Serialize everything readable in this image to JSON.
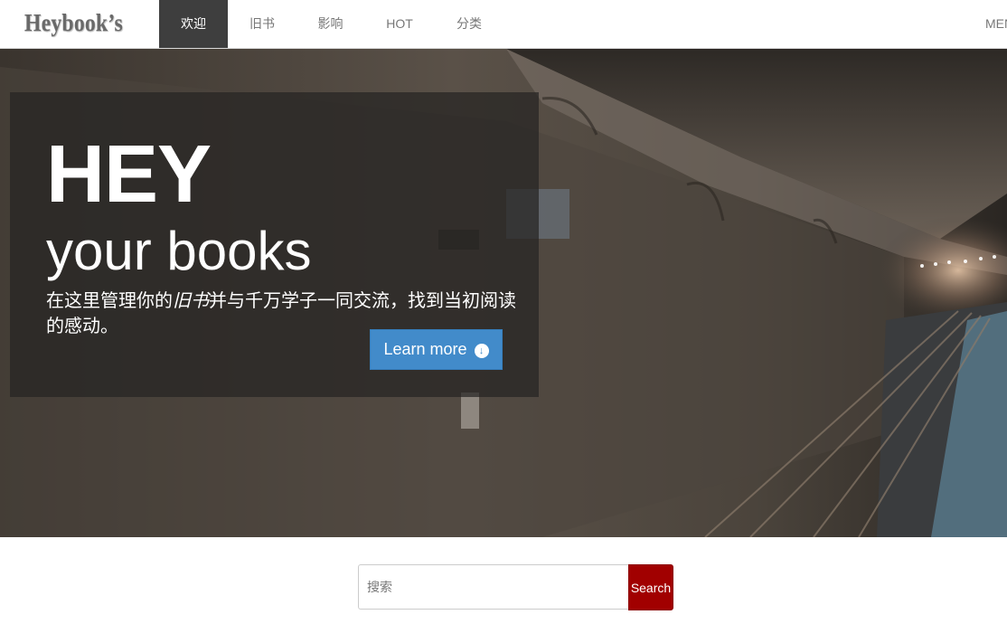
{
  "brand": "Heybook’s",
  "nav": {
    "items": [
      "欢迎",
      "旧书",
      "影响",
      "HOT",
      "分类"
    ],
    "active_index": 0,
    "menu_label": "MENU"
  },
  "hero": {
    "title": "HEY",
    "subtitle": "your books",
    "desc_before": "在这里管理你的",
    "desc_emphasis": "旧书",
    "desc_after": "并与千万学子一同交流，找到当初阅读的感动。",
    "button_label": "Learn more",
    "button_icon": "arrow-circle-down-icon"
  },
  "search": {
    "placeholder": "搜索",
    "value": "",
    "button_label": "Search"
  },
  "colors": {
    "nav_active_bg": "#3e3e3e",
    "learn_more_bg": "#428bca",
    "search_button_bg": "#a10000"
  }
}
